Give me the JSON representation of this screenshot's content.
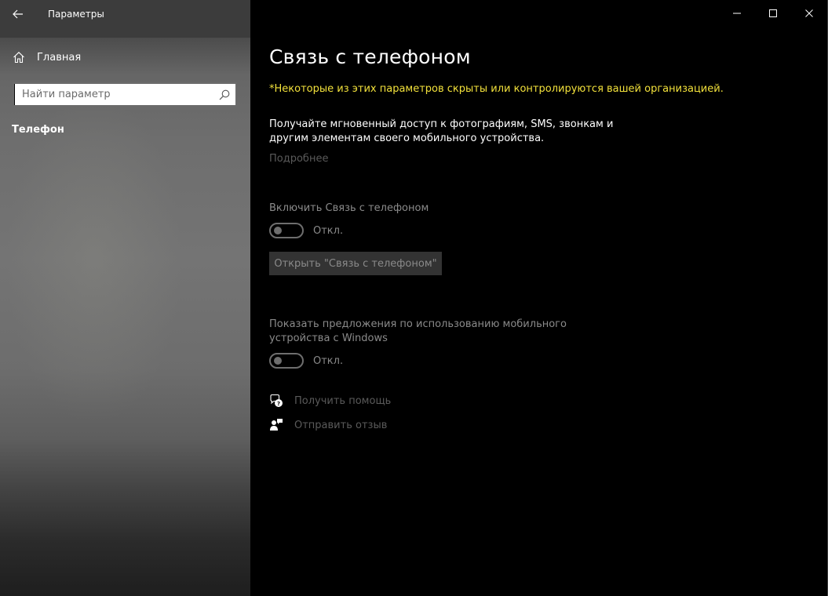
{
  "window": {
    "title": "Параметры"
  },
  "sidebar": {
    "home_label": "Главная",
    "search_placeholder": "Найти параметр",
    "section_title": "Телефон"
  },
  "main": {
    "title": "Связь с телефоном",
    "notice": "*Некоторые из этих параметров скрыты или контролируются вашей организацией.",
    "description": "Получайте мгновенный доступ к фотографиям, SMS, звонкам и другим элементам своего мобильного устройства.",
    "more_link": "Подробнее",
    "settings": [
      {
        "label": "Включить Связь с телефоном",
        "toggle_state": "Откл.",
        "is_on": false
      },
      {
        "label": "Показать предложения по использованию мобильного устройства с Windows",
        "toggle_state": "Откл.",
        "is_on": false
      }
    ],
    "open_button": "Открыть \"Связь с телефоном\"",
    "links": [
      {
        "label": "Получить помощь",
        "icon": "help-chat-icon"
      },
      {
        "label": "Отправить отзыв",
        "icon": "feedback-icon"
      }
    ]
  },
  "colors": {
    "notice": "#f2e13b",
    "disabled_text": "#8a8a8a",
    "muted_link": "#5a5a5a",
    "background": "#000000"
  }
}
